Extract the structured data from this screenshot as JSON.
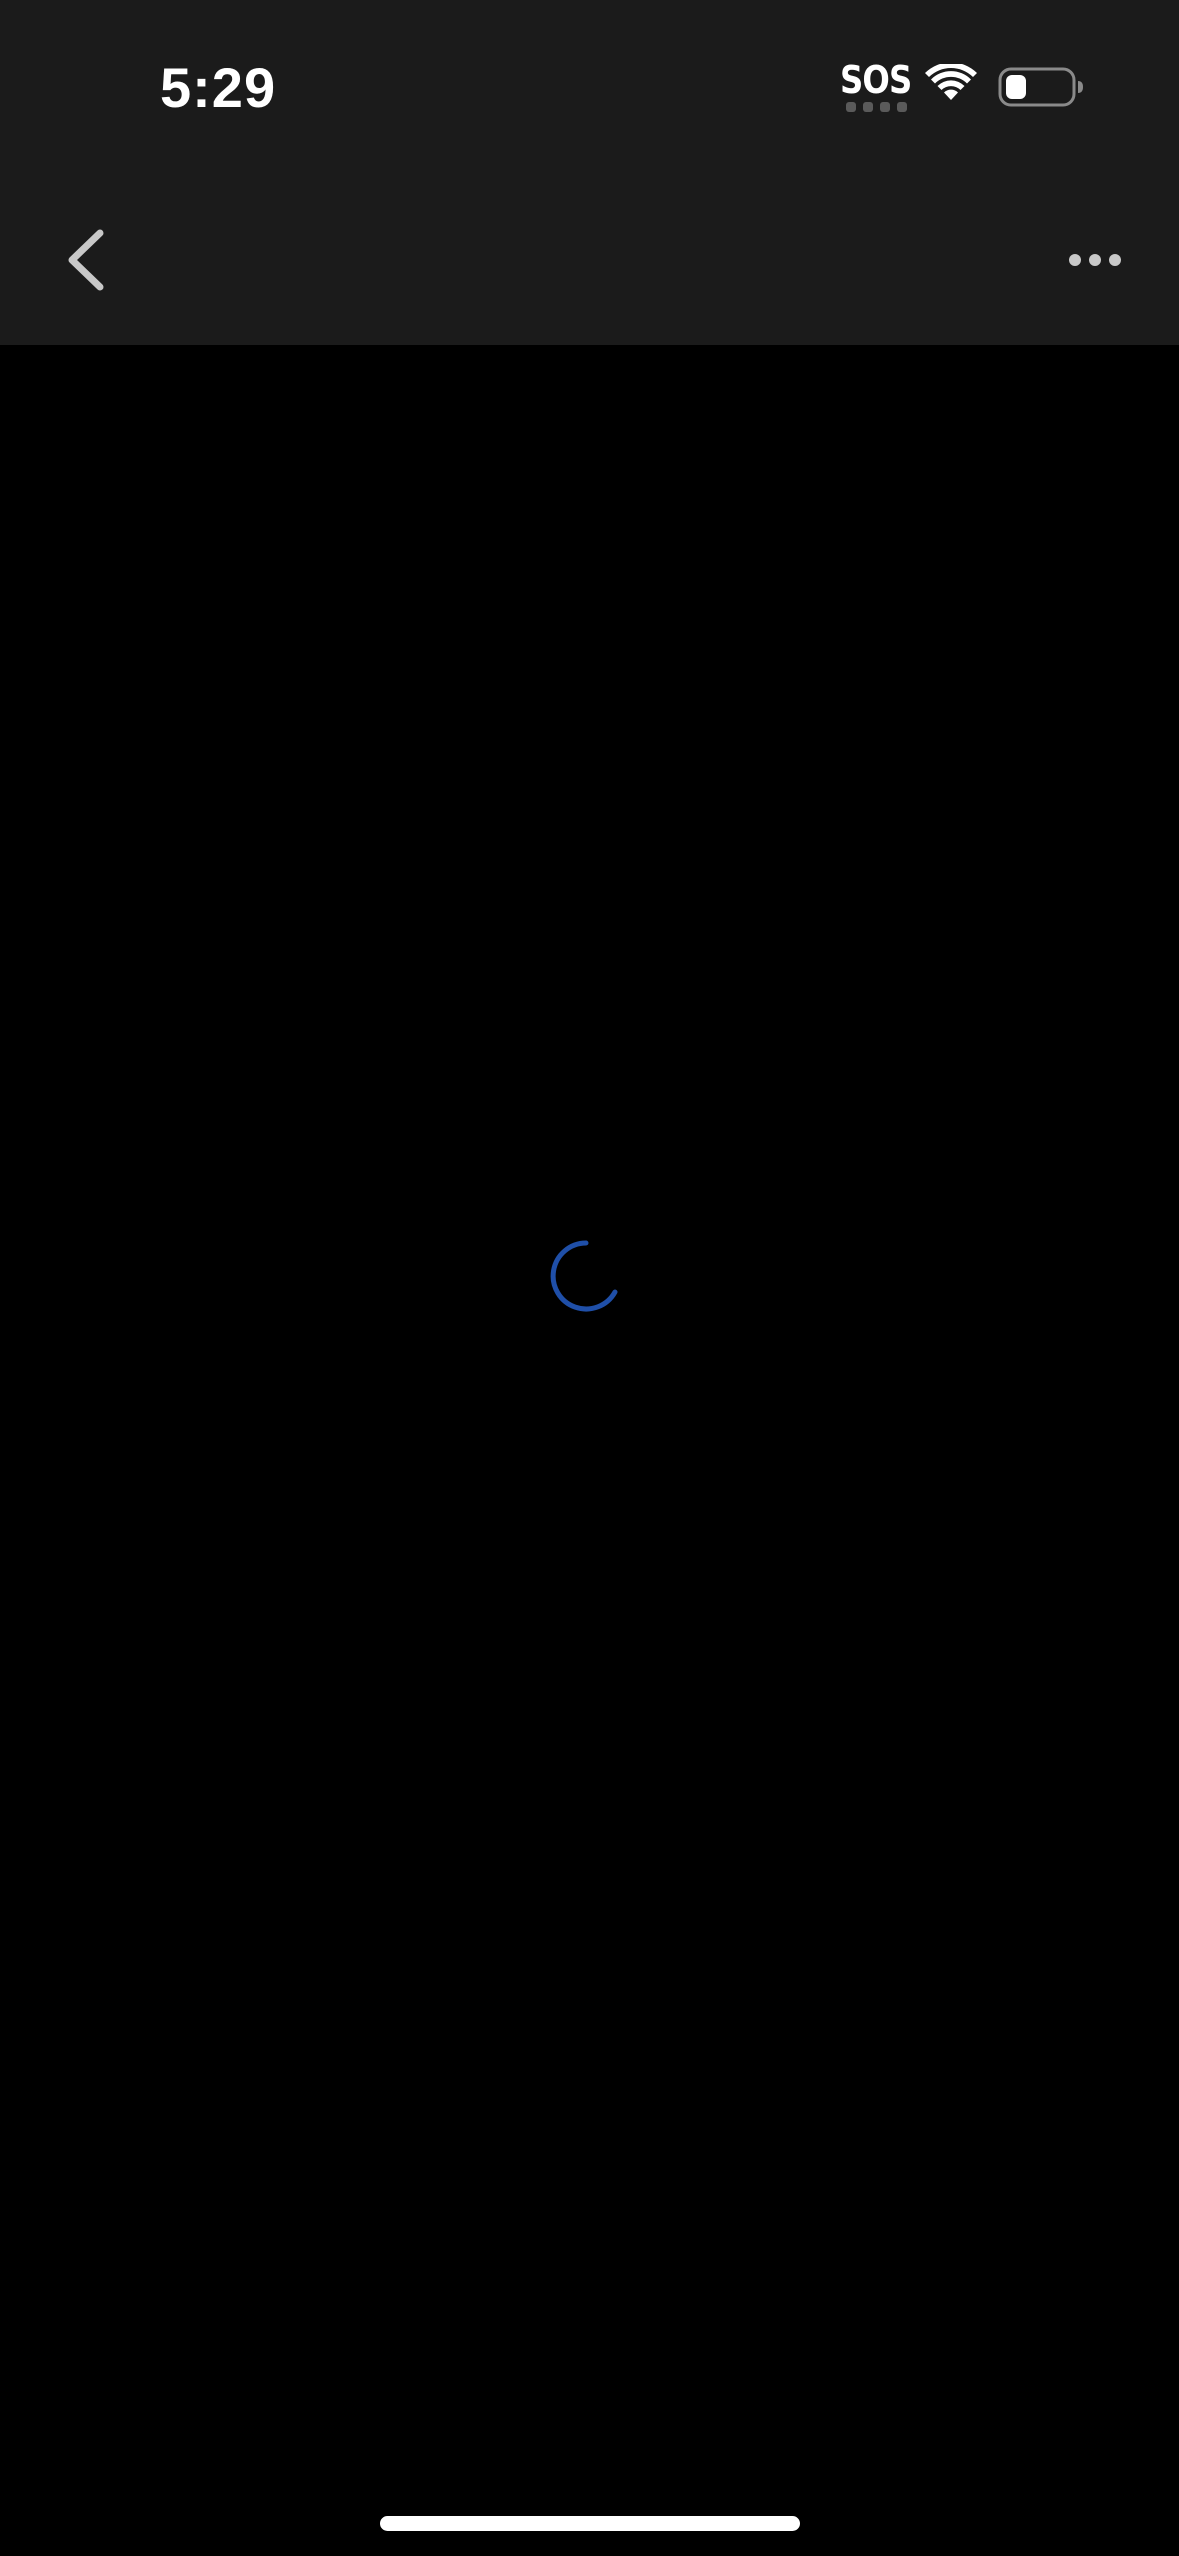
{
  "status_bar": {
    "time": "5:29",
    "sos_label": "SOS",
    "icons": [
      "wifi-icon",
      "battery-icon"
    ]
  },
  "nav_bar": {
    "back_icon": "chevron-left-icon",
    "more_icon": "ellipsis-icon"
  },
  "content": {
    "loading_indicator": "spinner-icon"
  },
  "colors": {
    "top_bar_background": "#1b1b1b",
    "content_background": "#000000",
    "spinner_color": "#1f4fa8",
    "icon_color": "#c8c8c8",
    "text_color": "#ffffff"
  }
}
